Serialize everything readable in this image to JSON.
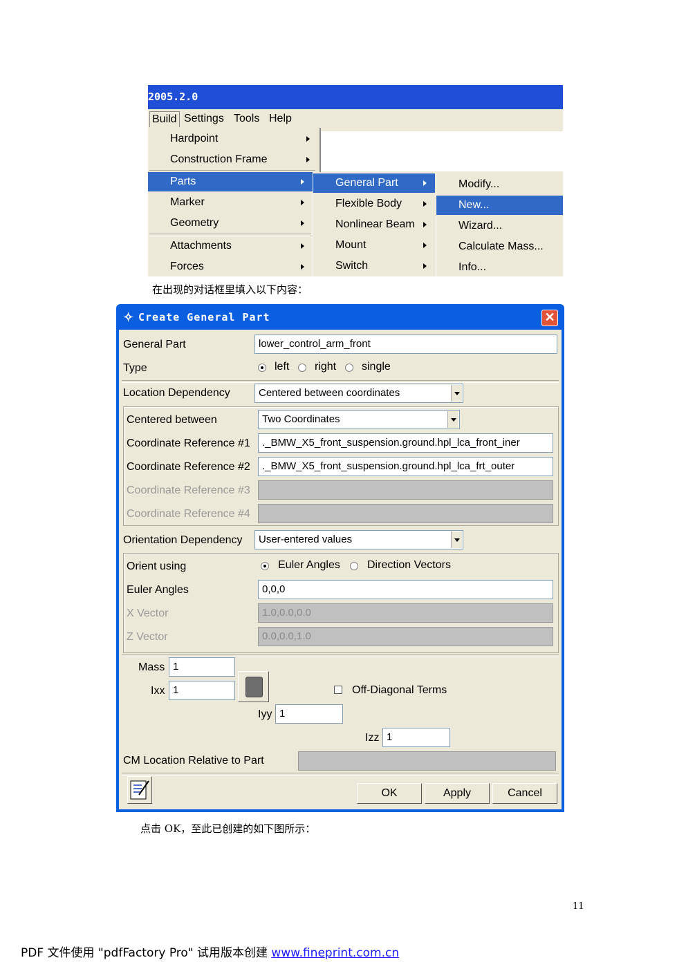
{
  "menu_screenshot": {
    "title": "2005.2.0",
    "menubar": [
      "Build",
      "Settings",
      "Tools",
      "Help"
    ],
    "build_menu": [
      "Hardpoint",
      "Construction Frame",
      "Parts",
      "Marker",
      "Geometry",
      "Attachments",
      "Forces"
    ],
    "parts_submenu": [
      "General Part",
      "Flexible Body",
      "Nonlinear Beam",
      "Mount",
      "Switch"
    ],
    "general_part_submenu": [
      "Modify...",
      "New...",
      "Wizard...",
      "Calculate Mass...",
      "Info..."
    ]
  },
  "caption1": "在出现的对话框里填入以下内容：",
  "dialog": {
    "title": "Create General Part",
    "general_part_label": "General Part",
    "general_part_value": "lower_control_arm_front",
    "type_label": "Type",
    "type_options": [
      "left",
      "right",
      "single"
    ],
    "type_selected": "left",
    "location_dependency_label": "Location Dependency",
    "location_dependency_value": "Centered between coordinates",
    "centered_between_label": "Centered between",
    "centered_between_value": "Two Coordinates",
    "coord_ref1_label": "Coordinate Reference #1",
    "coord_ref1_value": "._BMW_X5_front_suspension.ground.hpl_lca_front_iner",
    "coord_ref2_label": "Coordinate Reference #2",
    "coord_ref2_value": "._BMW_X5_front_suspension.ground.hpl_lca_frt_outer",
    "coord_ref3_label": "Coordinate Reference #3",
    "coord_ref4_label": "Coordinate Reference #4",
    "orientation_dependency_label": "Orientation Dependency",
    "orientation_dependency_value": "User-entered values",
    "orient_using_label": "Orient using",
    "orient_options": [
      "Euler Angles",
      "Direction Vectors"
    ],
    "orient_selected": "Euler Angles",
    "euler_angles_label": "Euler Angles",
    "euler_angles_value": "0,0,0",
    "x_vector_label": "X Vector",
    "x_vector_value": "1.0,0.0,0.0",
    "z_vector_label": "Z Vector",
    "z_vector_value": "0.0,0.0,1.0",
    "mass_label": "Mass",
    "mass_value": "1",
    "ixx_label": "Ixx",
    "ixx_value": "1",
    "iyy_label": "Iyy",
    "iyy_value": "1",
    "izz_label": "Izz",
    "izz_value": "1",
    "off_diagonal_label": "Off-Diagonal Terms",
    "cm_location_label": "CM Location Relative to Part",
    "cm_location_value": "",
    "ok_label": "OK",
    "apply_label": "Apply",
    "cancel_label": "Cancel"
  },
  "caption2": "点击 OK，至此已创建的如下图所示：",
  "page_number": "11",
  "footer": {
    "text": "PDF 文件使用 \"pdfFactory Pro\" 试用版本创建 ",
    "link": "www.fineprint.com.cn"
  }
}
